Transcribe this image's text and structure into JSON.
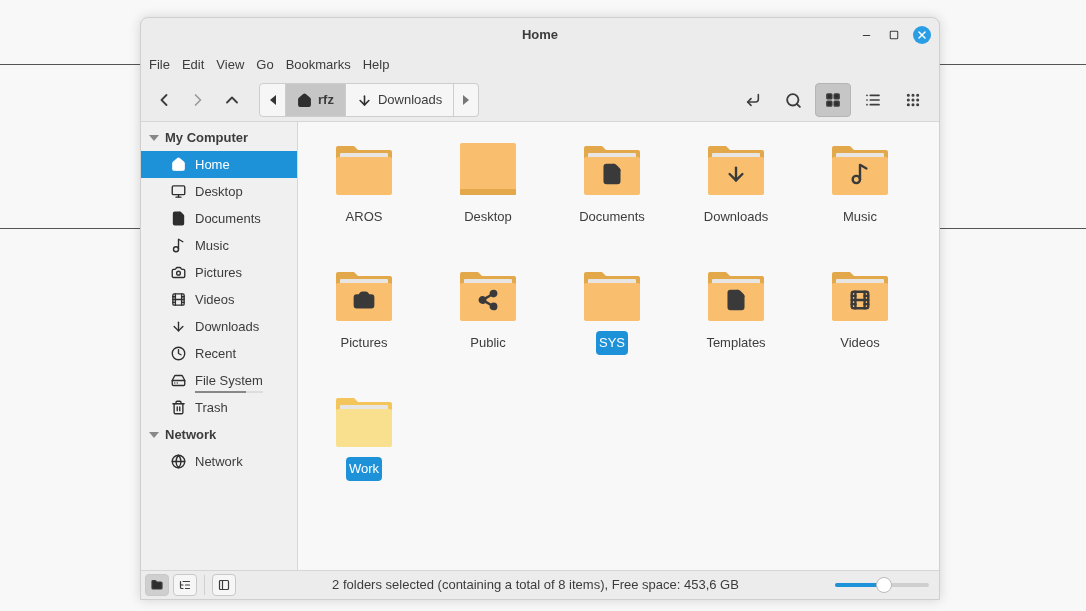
{
  "window": {
    "title": "Home"
  },
  "menu": [
    "File",
    "Edit",
    "View",
    "Go",
    "Bookmarks",
    "Help"
  ],
  "breadcrumb": [
    {
      "label": "rfz",
      "kind": "home",
      "selected": true
    },
    {
      "label": "Downloads",
      "kind": "downloads",
      "selected": false
    }
  ],
  "view_buttons": [
    {
      "kind": "icons",
      "selected": true
    },
    {
      "kind": "list",
      "selected": false
    },
    {
      "kind": "compact",
      "selected": false
    }
  ],
  "sidebar": [
    {
      "title": "My Computer",
      "expanded": true,
      "items": [
        {
          "label": "Home",
          "kind": "home",
          "selected": true
        },
        {
          "label": "Desktop",
          "kind": "desktop",
          "selected": false
        },
        {
          "label": "Documents",
          "kind": "documents",
          "selected": false
        },
        {
          "label": "Music",
          "kind": "music",
          "selected": false
        },
        {
          "label": "Pictures",
          "kind": "pictures",
          "selected": false
        },
        {
          "label": "Videos",
          "kind": "videos",
          "selected": false
        },
        {
          "label": "Downloads",
          "kind": "downloads",
          "selected": false
        },
        {
          "label": "Recent",
          "kind": "recent",
          "selected": false
        },
        {
          "label": "File System",
          "kind": "drive",
          "selected": false,
          "level": 0.75
        },
        {
          "label": "Trash",
          "kind": "trash",
          "selected": false
        }
      ]
    },
    {
      "title": "Network",
      "expanded": true,
      "items": [
        {
          "label": "Network",
          "kind": "network",
          "selected": false
        }
      ]
    }
  ],
  "files": [
    {
      "name": "AROS",
      "kind": "folder",
      "color": "#f9bf6f",
      "selected": false
    },
    {
      "name": "Desktop",
      "kind": "desktop",
      "color": "#f9bf6f",
      "selected": false
    },
    {
      "name": "Documents",
      "kind": "documents",
      "color": "#f9bf6f",
      "selected": false
    },
    {
      "name": "Downloads",
      "kind": "downloads",
      "color": "#f9bf6f",
      "selected": false
    },
    {
      "name": "Music",
      "kind": "music",
      "color": "#f9bf6f",
      "selected": false
    },
    {
      "name": "Pictures",
      "kind": "pictures",
      "color": "#f9bf6f",
      "selected": false
    },
    {
      "name": "Public",
      "kind": "public",
      "color": "#f9bf6f",
      "selected": false
    },
    {
      "name": "SYS",
      "kind": "folder",
      "color": "#f9bf6f",
      "selected": true
    },
    {
      "name": "Templates",
      "kind": "templates",
      "color": "#f9bf6f",
      "selected": false
    },
    {
      "name": "Videos",
      "kind": "videos",
      "color": "#f9bf6f",
      "selected": false
    },
    {
      "name": "Work",
      "kind": "folder",
      "color": "#f8e08e",
      "selected": true
    }
  ],
  "status_bar": {
    "text": "2 folders selected (containing a total of 8 items), Free space: 453,6 GB",
    "pane_buttons": [
      {
        "kind": "places",
        "selected": true
      },
      {
        "kind": "tree",
        "selected": false
      }
    ],
    "zoom": {
      "level": 0.52
    }
  }
}
